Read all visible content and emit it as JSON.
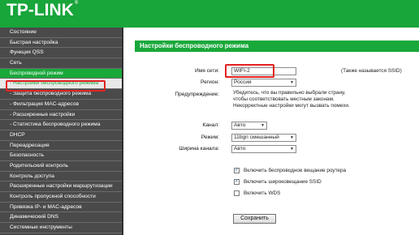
{
  "brand": {
    "logo_text": "TP-LINK",
    "trademark": "®",
    "header_color": "#18a53a"
  },
  "sidebar": {
    "items": [
      {
        "label": "Состояние"
      },
      {
        "label": "Быстрая настройка"
      },
      {
        "label": "Функция QSS"
      },
      {
        "label": "Сеть"
      },
      {
        "label": "Беспроводной режим"
      },
      {
        "label": "- Настройки беспроводного режима"
      },
      {
        "label": "- Защита беспроводного режима"
      },
      {
        "label": "- Фильтрация MAC-адресов"
      },
      {
        "label": "- Расширенные настройки"
      },
      {
        "label": "- Статистика беспроводного режима"
      },
      {
        "label": "DHCP"
      },
      {
        "label": "Переадресация"
      },
      {
        "label": "Безопасность"
      },
      {
        "label": "Родительский контроль"
      },
      {
        "label": "Контроль доступа"
      },
      {
        "label": "Расширенные настройки маршрутизации"
      },
      {
        "label": "Контроль пропускной способности"
      },
      {
        "label": "Привязка IP- и MAC-адресов"
      },
      {
        "label": "Динамический DNS"
      },
      {
        "label": "Системные инструменты"
      }
    ],
    "active_section": "Беспроводной режим",
    "selected_item": "- Настройки беспроводного режима"
  },
  "main": {
    "title": "Настройки беспроводного режима",
    "ssid": {
      "label": "Имя сети:",
      "value": "WIFI-2",
      "hint": "(Также называется SSID)"
    },
    "region": {
      "label": "Регион:",
      "value": "Россия"
    },
    "warning": {
      "label": "Предупреждение:",
      "lines": [
        "Убедитесь, что вы правильно выбрали страну,",
        "чтобы соответствовать местным законам.",
        "Некорректные настройки могут вызвать помехи."
      ]
    },
    "channel": {
      "label": "Канал:",
      "value": "Авто"
    },
    "mode": {
      "label": "Режим:",
      "value": "11bgn смешанный"
    },
    "width": {
      "label": "Ширина канала:",
      "value": "Авто"
    },
    "checkboxes": [
      {
        "label": "Включить беспроводное вещание роутера",
        "checked": true
      },
      {
        "label": "Включить широковещание SSID",
        "checked": true
      },
      {
        "label": "Включить WDS",
        "checked": false
      }
    ],
    "save_label": "Сохранить"
  }
}
